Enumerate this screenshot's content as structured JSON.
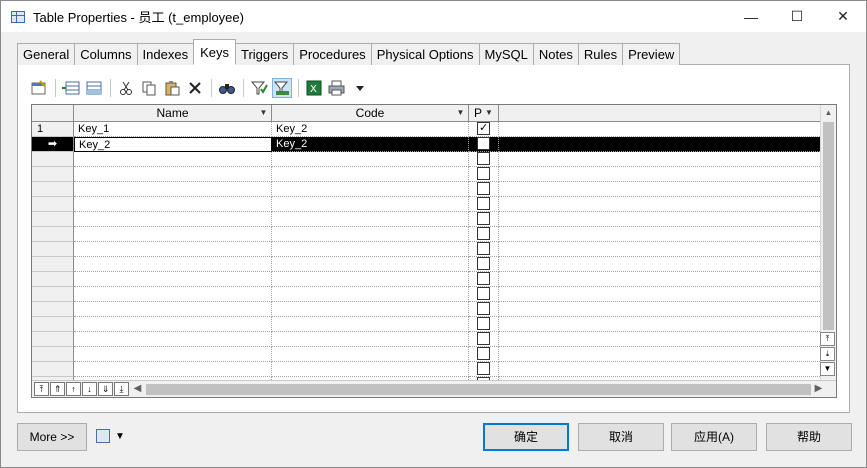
{
  "window": {
    "title": "Table Properties - 员工 (t_employee)",
    "controls": {
      "minimize": "—",
      "maximize": "☐",
      "close": "✕"
    }
  },
  "tabs": [
    {
      "label": "General",
      "active": false
    },
    {
      "label": "Columns",
      "active": false
    },
    {
      "label": "Indexes",
      "active": false
    },
    {
      "label": "Keys",
      "active": true
    },
    {
      "label": "Triggers",
      "active": false
    },
    {
      "label": "Procedures",
      "active": false
    },
    {
      "label": "Physical Options",
      "active": false
    },
    {
      "label": "MySQL",
      "active": false
    },
    {
      "label": "Notes",
      "active": false
    },
    {
      "label": "Rules",
      "active": false
    },
    {
      "label": "Preview",
      "active": false
    }
  ],
  "toolbar": [
    "properties-icon",
    "insert-row-icon",
    "add-row-icon",
    "cut-icon",
    "copy-icon",
    "paste-icon",
    "delete-icon",
    "find-icon",
    "filter-icon",
    "customize-columns-icon",
    "excel-icon",
    "print-icon",
    "dropdown-icon"
  ],
  "grid": {
    "columns": [
      "Name",
      "Code",
      "P"
    ],
    "rows": [
      {
        "num": "1",
        "name": "Key_1",
        "code": "Key_2",
        "primary": true,
        "selected": false
      },
      {
        "num": "➡",
        "name": "Key_2",
        "code": "Key_2",
        "primary": false,
        "selected": true
      }
    ],
    "empty_rows": 16
  },
  "footer": {
    "more": "More >>",
    "ok": "确定",
    "cancel": "取消",
    "apply": "应用(A)",
    "help": "帮助"
  }
}
